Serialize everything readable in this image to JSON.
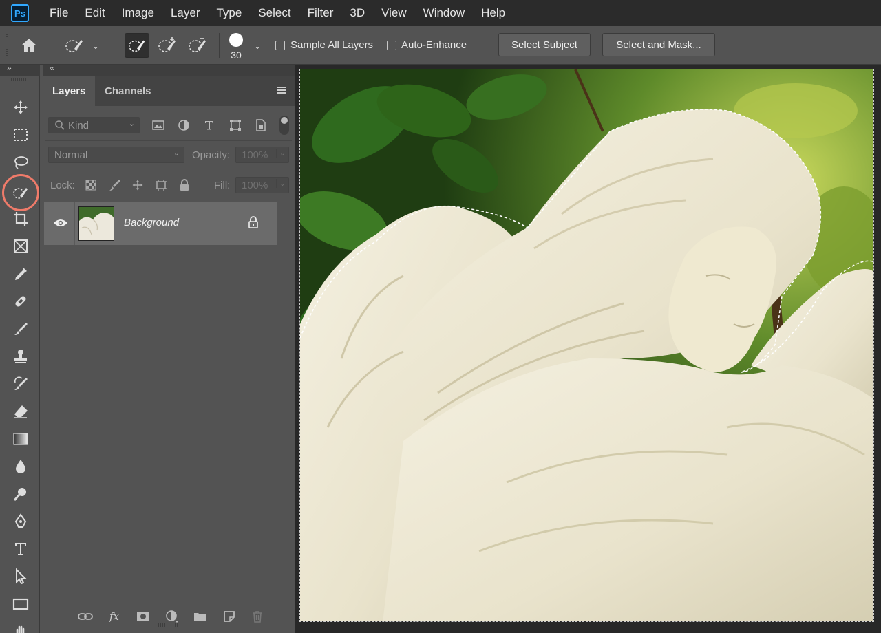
{
  "app": {
    "logo_text": "Ps"
  },
  "menu": [
    "File",
    "Edit",
    "Image",
    "Layer",
    "Type",
    "Select",
    "Filter",
    "3D",
    "View",
    "Window",
    "Help"
  ],
  "options_bar": {
    "brush_size": "30",
    "sample_all_layers_label": "Sample All Layers",
    "sample_all_layers_checked": false,
    "auto_enhance_label": "Auto-Enhance",
    "auto_enhance_checked": false,
    "select_subject_label": "Select Subject",
    "select_and_mask_label": "Select and Mask..."
  },
  "toolbar": {
    "active_tool": "quick-selection-tool",
    "highlight_color": "#ef7b6a",
    "tools": [
      "move-tool",
      "marquee-tool",
      "lasso-tool",
      "quick-selection-tool",
      "crop-tool",
      "frame-tool",
      "eyedropper-tool",
      "healing-brush-tool",
      "brush-tool",
      "clone-stamp-tool",
      "history-brush-tool",
      "eraser-tool",
      "gradient-tool",
      "blur-tool",
      "dodge-tool",
      "pen-tool",
      "type-tool",
      "path-selection-tool",
      "rectangle-tool",
      "hand-tool"
    ]
  },
  "panel": {
    "tabs": [
      {
        "label": "Layers",
        "active": true
      },
      {
        "label": "Channels",
        "active": false
      }
    ],
    "filter_placeholder": "Kind",
    "blend_mode": "Normal",
    "opacity_label": "Opacity:",
    "opacity_value": "100%",
    "lock_label": "Lock:",
    "fill_label": "Fill:",
    "fill_value": "100%",
    "layers": [
      {
        "name": "Background",
        "visible": true,
        "locked": true
      }
    ],
    "bottom_fx_label": "fx"
  },
  "colors": {
    "menubar_bg": "#2b2b2b",
    "panel_bg": "#535353",
    "canvas_bg": "#282828",
    "accent_blue": "#31a8ff"
  }
}
